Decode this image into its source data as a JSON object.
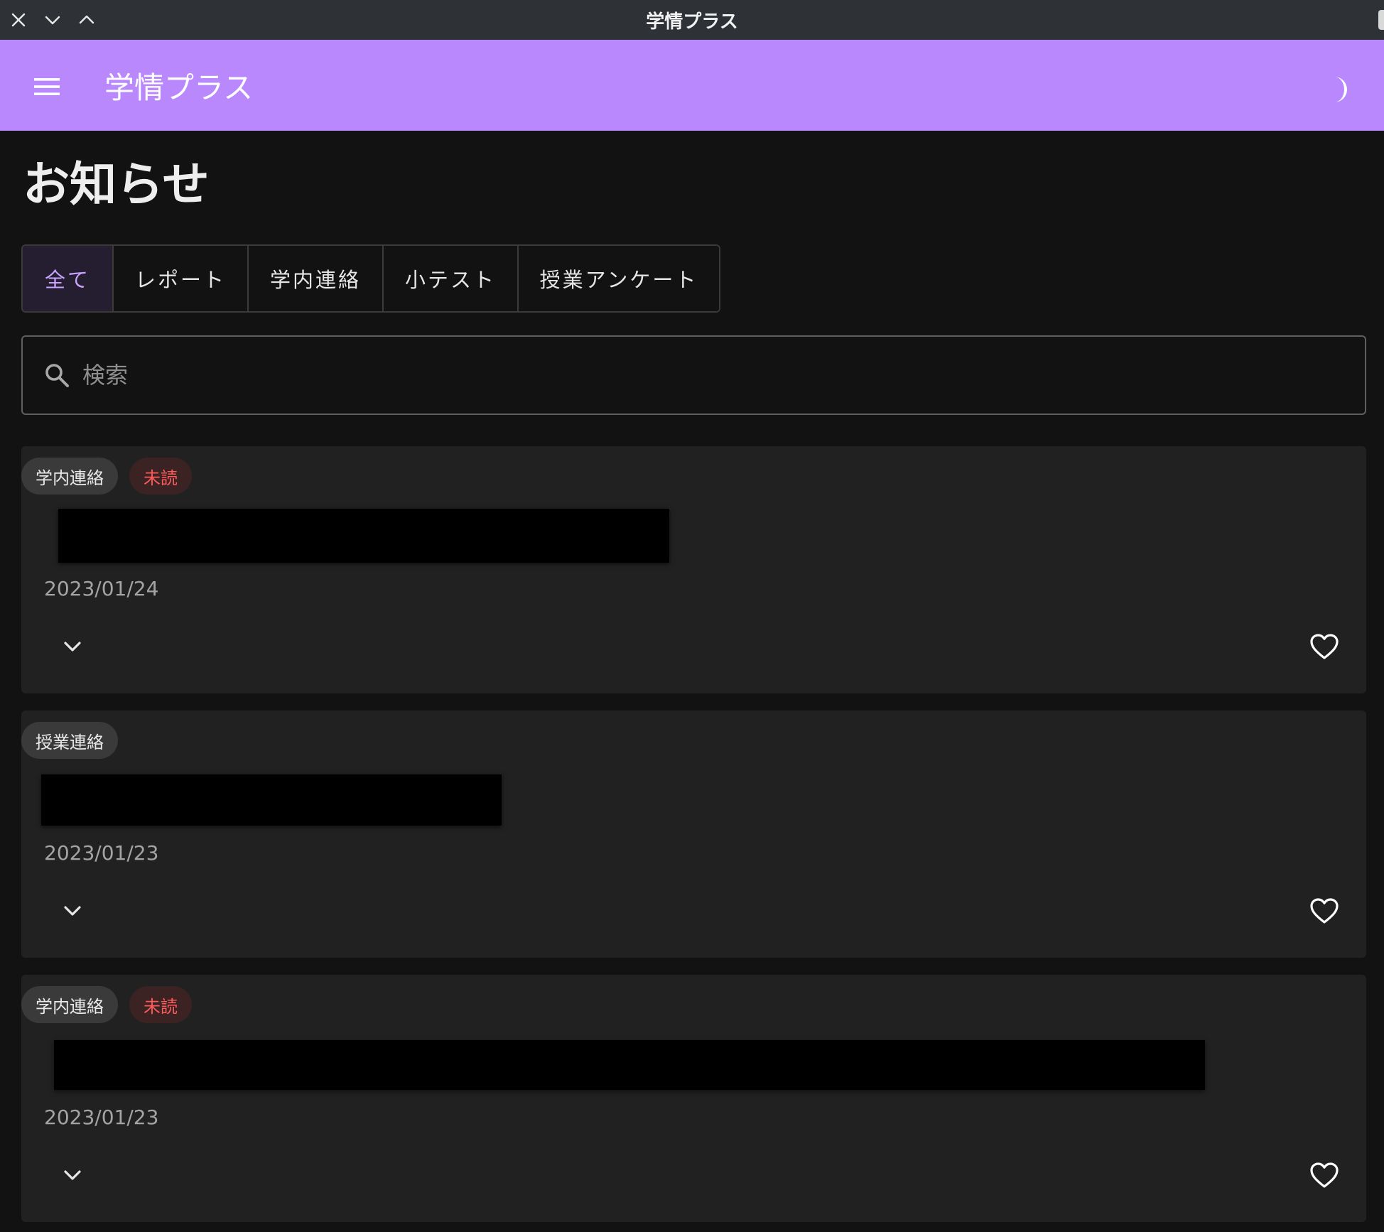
{
  "window": {
    "title": "学情プラス"
  },
  "appbar": {
    "title": "学情プラス",
    "color": "#b988fd"
  },
  "page": {
    "title": "お知らせ"
  },
  "tabs": [
    {
      "label": "全て",
      "active": true
    },
    {
      "label": "レポート",
      "active": false
    },
    {
      "label": "学内連絡",
      "active": false
    },
    {
      "label": "小テスト",
      "active": false
    },
    {
      "label": "授業アンケート",
      "active": false
    }
  ],
  "search": {
    "placeholder": "検索",
    "value": ""
  },
  "notices": [
    {
      "category": "学内連絡",
      "status": "未読",
      "date": "2023/01/24",
      "favorited": false
    },
    {
      "category": "授業連絡",
      "status": "",
      "date": "2023/01/23",
      "favorited": false
    },
    {
      "category": "学内連絡",
      "status": "未読",
      "date": "2023/01/23",
      "favorited": false
    }
  ],
  "icons": {
    "close": "close-icon",
    "minimize": "chevron-down-icon",
    "maximize": "chevron-up-icon",
    "menu": "menu-icon",
    "theme": "moon-icon",
    "search": "search-icon",
    "expand": "chevron-down-icon",
    "favorite": "heart-outline-icon"
  },
  "colors": {
    "accent": "#b988fd",
    "active_tab_text": "#c9a3ff",
    "unread": "#ff5a5a"
  }
}
